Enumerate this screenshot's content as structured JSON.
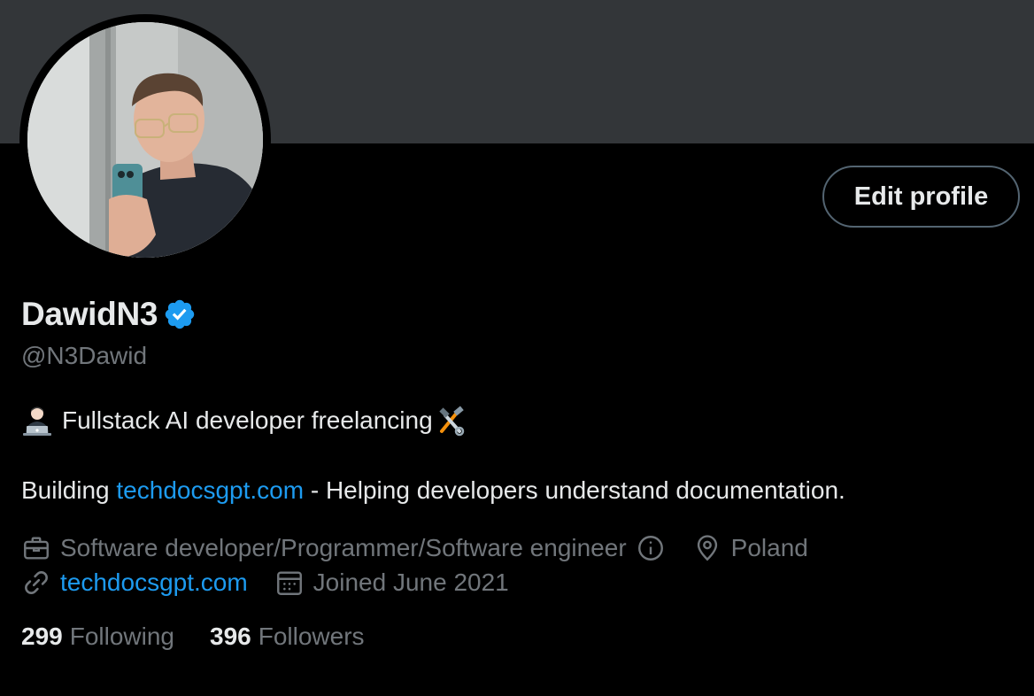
{
  "profile": {
    "display_name": "DawidN3",
    "handle": "@N3Dawid",
    "edit_button_label": "Edit profile",
    "bio_line1_text": "Fullstack AI developer freelancing",
    "bio_line2_prefix": "Building ",
    "bio_line2_link": "techdocsgpt.com",
    "bio_line2_suffix": " - Helping developers understand documentation.",
    "profession": "Software developer/Programmer/Software engineer",
    "location": "Poland",
    "website": "techdocsgpt.com",
    "joined": "Joined June 2021",
    "following_count": "299",
    "following_label": "Following",
    "followers_count": "396",
    "followers_label": "Followers"
  },
  "icons": {
    "verified": "verified-badge-icon",
    "bio_emoji_1": "technologist-emoji-icon",
    "bio_emoji_2": "hammer-and-wrench-emoji-icon",
    "profession": "briefcase-icon",
    "info": "info-circle-icon",
    "location": "location-pin-icon",
    "website": "link-icon",
    "joined": "calendar-icon"
  },
  "colors": {
    "background": "#000000",
    "banner": "#333639",
    "primary_text": "#e7e9ea",
    "secondary_text": "#71767b",
    "link": "#1d9bf0",
    "button_border": "#536471"
  }
}
